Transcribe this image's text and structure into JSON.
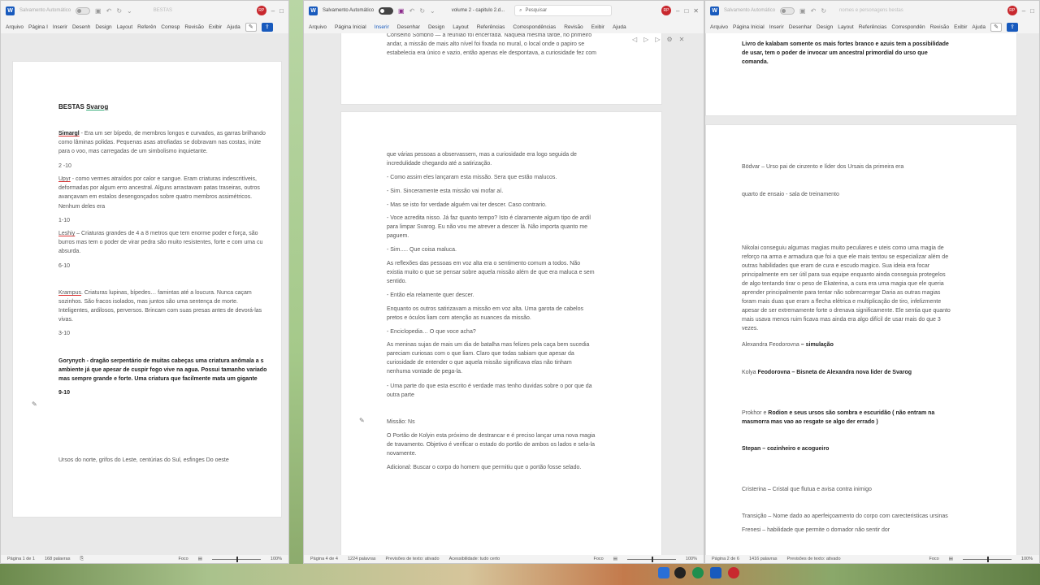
{
  "left": {
    "titlebar": {
      "autosave": "Salvamento Automático",
      "doc_title": "BESTAS",
      "avatar": "RP"
    },
    "menu": [
      "Arquivo",
      "Página I",
      "Inserir",
      "Desenh",
      "Design",
      "Layout",
      "Referên",
      "Corresp",
      "Revisão",
      "Exibir",
      "Ajuda"
    ],
    "page": {
      "title_a": "BESTAS ",
      "title_b": "Svarog",
      "simargl_name": "Simargl",
      "simargl_text": " - Era um ser bípedo, de membros longos e curvados, as garras brilhando",
      "simargl_2": "como lâminas polidas. Pequenas asas atrofiadas se dobravam nas costas, inúte",
      "simargl_3": "para o voo, mas carregadas de um simbolismo inquietante.",
      "r1": "2 -10",
      "upyr_name": "Upyr",
      "upyr_text": " - como vermes atraídos por calor e sangue. Eram criaturas indescritíveis,",
      "upyr_2": "deformadas por algum erro ancestral. Alguns arrastavam patas traseiras, outros",
      "upyr_3": "avançavam em estalos desengonçados sobre quatro membros assimétricos.",
      "upyr_4": "Nenhum deles era",
      "r2": "1-10",
      "leshiy_name": "Leshiy",
      "leshiy_text": " – Criaturas grandes de 4 a 8 metros que tem enorme poder e força, são",
      "leshiy_2": "burros mas tem o poder de virar pedra são muito resistentes, forte e com uma cu",
      "leshiy_3": "absurda.",
      "r3": "6-10",
      "krampus_name": "Krampus",
      "krampus_text": ". Criaturas lupinas, bípedes… famintas até a loucura. Nunca caçam",
      "krampus_2": "sozinhos. São fracos isolados, mas juntos são uma sentença de morte.",
      "krampus_3": "Inteligentes, ardilosos, perversos. Brincam com suas presas antes de devorá-las",
      "krampus_4": "vivas.",
      "r4": "3-10",
      "gory_1": "Gorynych - dragão serpentário de muitas cabeças uma criatura anômala a s",
      "gory_2": "ambiente já que apesar de cuspir fogo vive na agua. Possui tamanho variado",
      "gory_3": "mas sempre grande e forte. Uma criatura que facilmente mata um gigante",
      "r5": "9-10",
      "ursos": "Ursos do norte, grifos do Leste, centúrias do Sul, esfinges Do oeste"
    },
    "status": {
      "page": "Página 1 de 1",
      "words": "168 palavras",
      "focus": "Foco",
      "zoom": "100%"
    }
  },
  "middle": {
    "titlebar": {
      "autosave": "Salvamento Automático",
      "doc_title": "volume 2 - capitulo 2.d...",
      "search": "Pesquisar",
      "avatar": "RP"
    },
    "menu": [
      "Arquivo",
      "Página Inicial",
      "Inserir",
      "Desenhar",
      "Design",
      "Layout",
      "Referências",
      "Correspondências",
      "Revisão",
      "Exibir",
      "Ajuda"
    ],
    "page1": [
      "Conselho Sombrio — a reunião foi encerrada. Naquela mesma tarde, no primeiro",
      "andar, a missão de mais alto nível foi fixada no mural, o local onde o papiro se",
      "estabelecia era único e vazio, então apenas ele despontava, a curiosidade fez com"
    ],
    "page2": {
      "p1": "que várias pessoas a observassem, mas a curiosidade era logo seguida de",
      "p1b": "incredulidade chegando até a satirização.",
      "p2": "- Como assim eles lançaram esta missão. Sera que estão malucos.",
      "p3": "- Sim. Sinceramente esta missão vai mofar aí.",
      "p4": "- Mas se isto for verdade alguém vai ter descer. Caso contrario.",
      "p5": "- Voce acredita nisso. Já faz quanto tempo? Isto é claramente algum tipo de ardil",
      "p5b": "para limpar Svarog. Eu não vou me atrever a descer lá. Não importa quanto me",
      "p5c": "paguem.",
      "p6": "- Sim..... Que coisa maluca.",
      "p7": "As reflexões das pessoas em voz alta era o sentimento comum a todos. Não",
      "p7b": "existia muito o que se pensar sobre aquela missão além de que era maluca e sem",
      "p7c": "sentido.",
      "p8": "- Então ela relamente quer descer.",
      "p9": "Enquanto os outros satirizavam a missão em voz alta. Uma garota de cabelos",
      "p9b": "pretos e óculos liam com atenção as nuances da missão.",
      "p10": "- Enciclopedia… O que voce acha?",
      "p11": "As meninas sujas de mais um dia de batalha mas felizes pela caça bem sucedia",
      "p11b": "pareciam curiosas com o que liam. Claro que todas sabiam que apesar da",
      "p11c": "curiosidade de entender o que aquela missão significava elas não tinham",
      "p11d": "nenhuma vontade de pega-la.",
      "p12": "- Uma parte do que esta escrito é verdade mas tenho duvidas sobre o por que da",
      "p12b": "outra parte",
      "p13": "Missão: Ns",
      "p14": "O Portão de Kolyin esta próximo de destrancar e é preciso lançar uma nova magia",
      "p14b": "de travamento. Objetivo é verificar o estado do portão de ambos os lados e sela-la",
      "p14c": "novamente.",
      "p15": "Adicional:  Buscar o corpo do homem que permitiu que o portão fosse selado."
    },
    "status": {
      "page": "Página 4 de 4",
      "words": "1224 palavras",
      "predict": "Previsões de texto: ativado",
      "access": "Acessibilidade: tudo certo",
      "focus": "Foco",
      "zoom": "100%"
    }
  },
  "right": {
    "titlebar": {
      "autosave": "Salvamento Automático",
      "doc_title": "nomes e personagens bestas",
      "avatar": "RP"
    },
    "menu": [
      "Arquivo",
      "Página Inicial",
      "Inserir",
      "Desenhar",
      "Design",
      "Layout",
      "Referências",
      "Correspondên",
      "Revisão",
      "Exibir",
      "Ajuda"
    ],
    "page1": [
      "Livro de kalabam somente os mais fortes branco e azuis tem a possibilidade",
      "de usar, tem o poder de invocar um ancestral primordial do urso que",
      "comanda."
    ],
    "page2": {
      "bodvar": "Bödvar – Urso pai de cinzento e líder dos Ursais da primeira era",
      "quarto": "quarto de ensaio  - sala de treinamento",
      "nikolai": [
        "Nikolai conseguiu algumas magias muito peculiares e uteis como uma magia de",
        "reforço na arma e armadura que foi a que ele mais tentou se especializar além de",
        "outras habilidades que eram de cura e escudo magico. Sua ideia era focar",
        "principalmente em ser útil para sua equipe enquanto ainda conseguia protegelos",
        "de algo tentando tirar o peso de Ekaterina, a cura era uma magia que ele queria",
        "aprender principalmente para tentar não sobrecarregar Daria as outras magias",
        "foram mais duas que eram a flecha elétrica e multiplicação de tiro, infelizmente",
        "apesar de ser extremamente forte o drenava significamente. Ele sentia que quanto",
        "mais usava menos ruim ficava mas ainda era algo difícil de usar mais do que 3",
        "vezes."
      ],
      "alexandra_a": "Alexandra Feodorovna",
      "alexandra_b": " – simulação",
      "kolya_a": "Kolya ",
      "kolya_b": "Feodorovna – Bisneta de Alexandra nova lider de Svarog",
      "prokhor_a": "Prokhor e ",
      "prokhor_b": "Rodion e seus ursos são sombra e escuridão ( não entram na",
      "prokhor_c": "masmorra mas vao ao resgate se algo der errado )",
      "stepan": "Stepan – cozinheiro e acogueiro",
      "cristerina": "Cristerina – Cristal que flutua e avisa contra inimigo",
      "transicao": "Transição – Nome dado ao aperfeiçoamento do corpo com carecteristicas ursinas",
      "frenesi": "Frenesi – habilidade que permite o domador não sentir dor"
    },
    "status": {
      "page": "Página 2 de 6",
      "words": "1416 palavras",
      "predict": "Previsões de texto: ativado",
      "focus": "Foco",
      "zoom": "100%"
    }
  }
}
